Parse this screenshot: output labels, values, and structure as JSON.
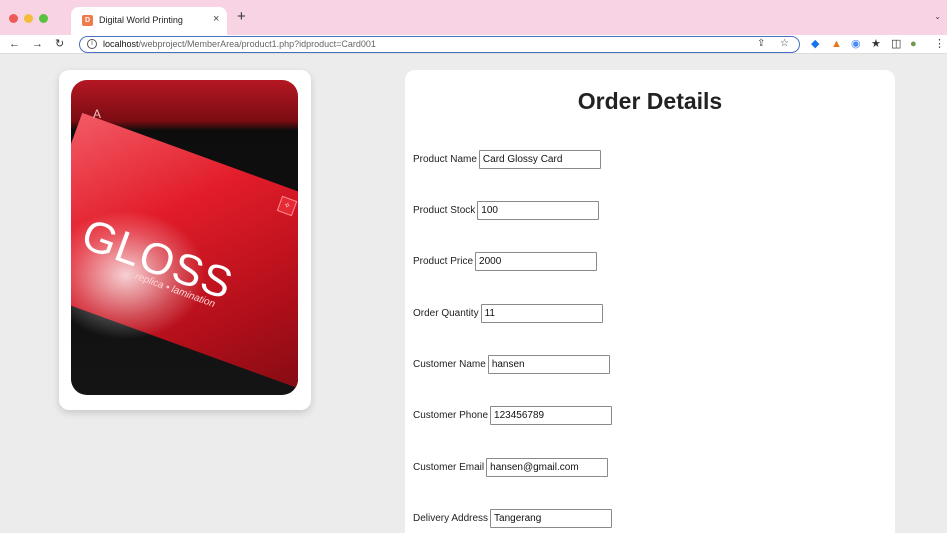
{
  "browser": {
    "tab_title": "Digital World Printing",
    "tab_close": "×",
    "new_tab": "+",
    "url_host": "localhost",
    "url_path": "/webproject/MemberArea/product1.php?idproduct=Card001"
  },
  "product_image": {
    "corner_letter": "A",
    "brand_text": "GLOSS",
    "sub_text": "replica • lamination"
  },
  "order": {
    "title": "Order Details",
    "fields": [
      {
        "label": "Product Name",
        "value": "Card Glossy Card"
      },
      {
        "label": "Product Stock",
        "value": "100"
      },
      {
        "label": "Product Price",
        "value": "2000"
      },
      {
        "label": "Order Quantity",
        "value": "11"
      },
      {
        "label": "Customer Name",
        "value": "hansen"
      },
      {
        "label": "Customer Phone",
        "value": "123456789"
      },
      {
        "label": "Customer Email",
        "value": "hansen@gmail.com"
      },
      {
        "label": "Delivery Address",
        "value": "Tangerang"
      }
    ]
  }
}
